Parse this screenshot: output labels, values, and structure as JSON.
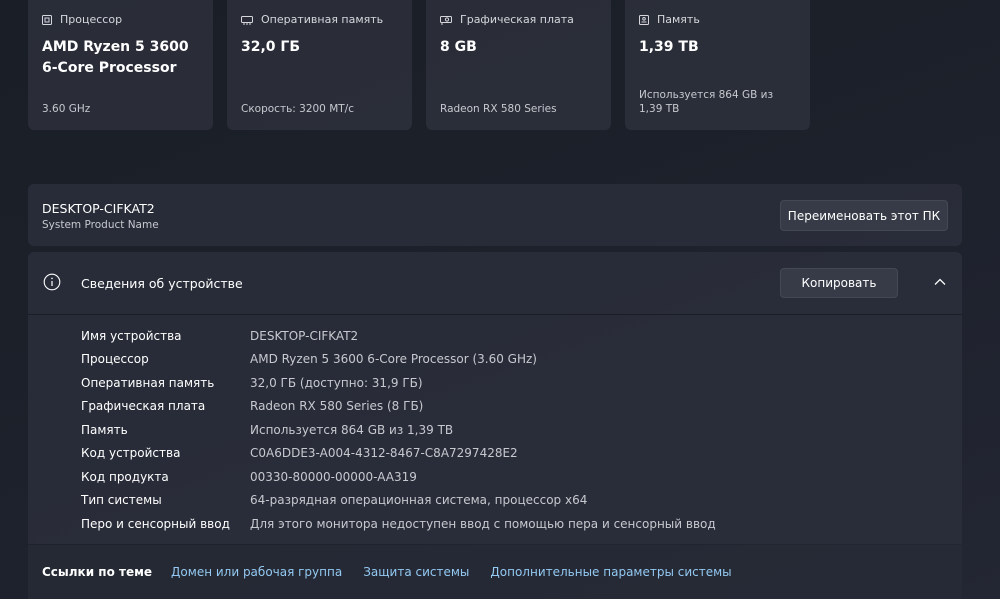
{
  "cards": [
    {
      "label": "Процессор",
      "icon": "cpu-icon",
      "value": "AMD Ryzen 5 3600 6-Core Processor",
      "sub": "3.60 GHz"
    },
    {
      "label": "Оперативная память",
      "icon": "ram-icon",
      "value": "32,0 ГБ",
      "sub": "Скорость: 3200 MT/с"
    },
    {
      "label": "Графическая плата",
      "icon": "gpu-icon",
      "value": "8 GB",
      "sub": "Radeon RX 580 Series"
    },
    {
      "label": "Память",
      "icon": "storage-icon",
      "value": "1,39 TB",
      "sub": "Используется 864 GB из 1,39 TB"
    }
  ],
  "pc": {
    "name": "DESKTOP-CIFKAT2",
    "subtitle": "System Product Name",
    "rename_label": "Переименовать этот ПК"
  },
  "device": {
    "title": "Сведения об устройстве",
    "copy_label": "Копировать",
    "specs": [
      {
        "label": "Имя устройства",
        "value": "DESKTOP-CIFKAT2"
      },
      {
        "label": "Процессор",
        "value": "AMD Ryzen 5 3600 6-Core Processor (3.60 GHz)"
      },
      {
        "label": "Оперативная память",
        "value": "32,0 ГБ (доступно: 31,9 ГБ)"
      },
      {
        "label": "Графическая плата",
        "value": "Radeon RX 580 Series (8 ГБ)"
      },
      {
        "label": "Память",
        "value": "Используется 864 GB из 1,39 TB"
      },
      {
        "label": "Код устройства",
        "value": "C0A6DDE3-A004-4312-8467-C8A7297428E2"
      },
      {
        "label": "Код продукта",
        "value": "00330-80000-00000-AA319"
      },
      {
        "label": "Тип системы",
        "value": "64-разрядная операционная система, процессор x64"
      },
      {
        "label": "Перо и сенсорный ввод",
        "value": "Для этого монитора недоступен ввод с помощью пера и сенсорный ввод"
      }
    ]
  },
  "related": {
    "title": "Ссылки по теме",
    "links": [
      "Домен или рабочая группа",
      "Защита системы",
      "Дополнительные параметры системы"
    ]
  },
  "colors": {
    "link": "#93c9f2",
    "card_bg": "#2e323e",
    "button_bg": "#373b47"
  }
}
